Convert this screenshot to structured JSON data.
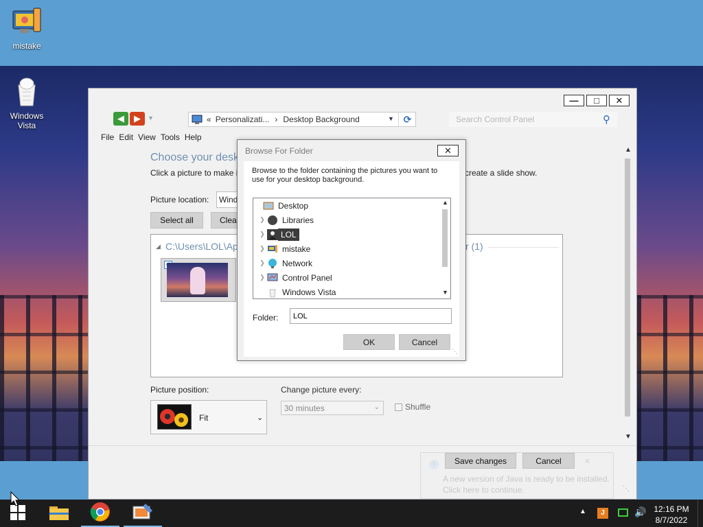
{
  "desktop": {
    "icons": [
      {
        "label": "mistake"
      },
      {
        "label": "Windows Vista"
      }
    ]
  },
  "window": {
    "nav": {
      "breadcrumb_prefix": "«",
      "breadcrumb_1": "Personalizati...",
      "breadcrumb_sep": "›",
      "breadcrumb_2": "Desktop Background",
      "search_placeholder": "Search Control Panel"
    },
    "menu": [
      "File",
      "Edit",
      "View",
      "Tools",
      "Help"
    ],
    "title": "Choose your desk",
    "subtitle": "Click a picture to make i",
    "subtitle_tail": "create a slide show.",
    "picture_location_label": "Picture location:",
    "picture_location_value": "Wind",
    "select_all": "Select all",
    "clear_all": "Clear",
    "group_path": "C:\\Users\\LOL\\Ap",
    "group_tail": "r (1)",
    "picture_position_label": "Picture position:",
    "picture_position_value": "Fit",
    "change_every_label": "Change picture every:",
    "change_every_value": "30 minutes",
    "shuffle_label": "Shuffle",
    "save_changes": "Save changes",
    "cancel": "Cancel"
  },
  "dialog": {
    "title": "Browse For Folder",
    "description": "Browse to the folder containing the pictures you want to use for your desktop background.",
    "tree": [
      {
        "label": "Desktop",
        "icon": "desktop-icon"
      },
      {
        "label": "Libraries",
        "icon": "libraries-icon"
      },
      {
        "label": "LOL",
        "icon": "user-icon",
        "selected": true
      },
      {
        "label": "mistake",
        "icon": "computer-icon"
      },
      {
        "label": "Network",
        "icon": "network-icon"
      },
      {
        "label": "Control Panel",
        "icon": "control-panel-icon"
      },
      {
        "label": "Windows Vista",
        "icon": "vista-icon"
      }
    ],
    "folder_label": "Folder:",
    "folder_value": "LOL",
    "ok": "OK",
    "cancel": "Cancel"
  },
  "notification": {
    "line1": "A new version of Java is ready to be installed.",
    "line2": "Click here to continue."
  },
  "taskbar": {
    "time": "12:16 PM",
    "date": "8/7/2022"
  },
  "colors": {
    "accent_title": "#6f8fb0",
    "taskbar": "#1c1c1c",
    "selected_tree": "#3c3c3c"
  }
}
